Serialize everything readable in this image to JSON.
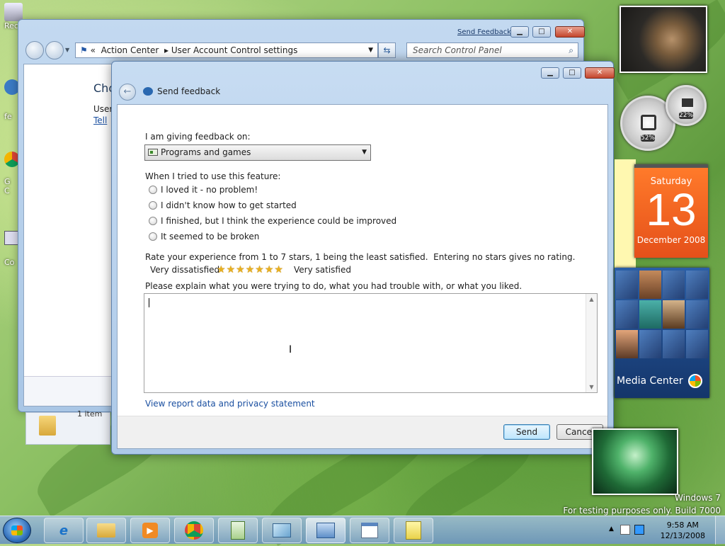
{
  "back_window": {
    "title_link": "Send Feedback",
    "breadcrumb": [
      "Action Center",
      "User Account Control settings"
    ],
    "breadcrumb_prefix": "«",
    "search_placeholder": "Search Control Panel",
    "partial_heading": "Cho",
    "partial_line1": "User",
    "partial_link": "Tell",
    "status_text": "1 item"
  },
  "feedback": {
    "title": "Send feedback",
    "giving_feedback_label": "I am giving feedback on:",
    "category_selected": "Programs and games",
    "tried_label": "When I tried to use this feature:",
    "options": [
      "I loved it - no problem!",
      "I didn't know how to get started",
      "I finished, but I think the experience could be improved",
      "It seemed to be broken"
    ],
    "rating_instructions": "Rate your experience from 1 to 7 stars, 1 being the least satisfied.  Entering no stars gives no rating.",
    "rating_low": "Very dissatisfied",
    "rating_high": "Very satisfied",
    "star_count": 7,
    "explain_label": "Please explain what you were trying to do, what you had trouble with, or what you liked.",
    "comment_value": "",
    "privacy_link": "View report data and privacy statement",
    "send_label": "Send",
    "cancel_label": "Cancel"
  },
  "gadgets": {
    "cpu_value": "52%",
    "mem_value": "22%",
    "calendar_day": "Saturday",
    "calendar_date": "13",
    "calendar_month": "December 2008",
    "media_center_label": "Media Center"
  },
  "desktop_icons": [
    "Rec",
    "fe",
    "G C",
    "Co"
  ],
  "watermark": {
    "line1": "Windows 7",
    "line2": "For testing purposes only. Build 7000"
  },
  "taskbar": {
    "time": "9:58 AM",
    "date": "12/13/2008"
  }
}
